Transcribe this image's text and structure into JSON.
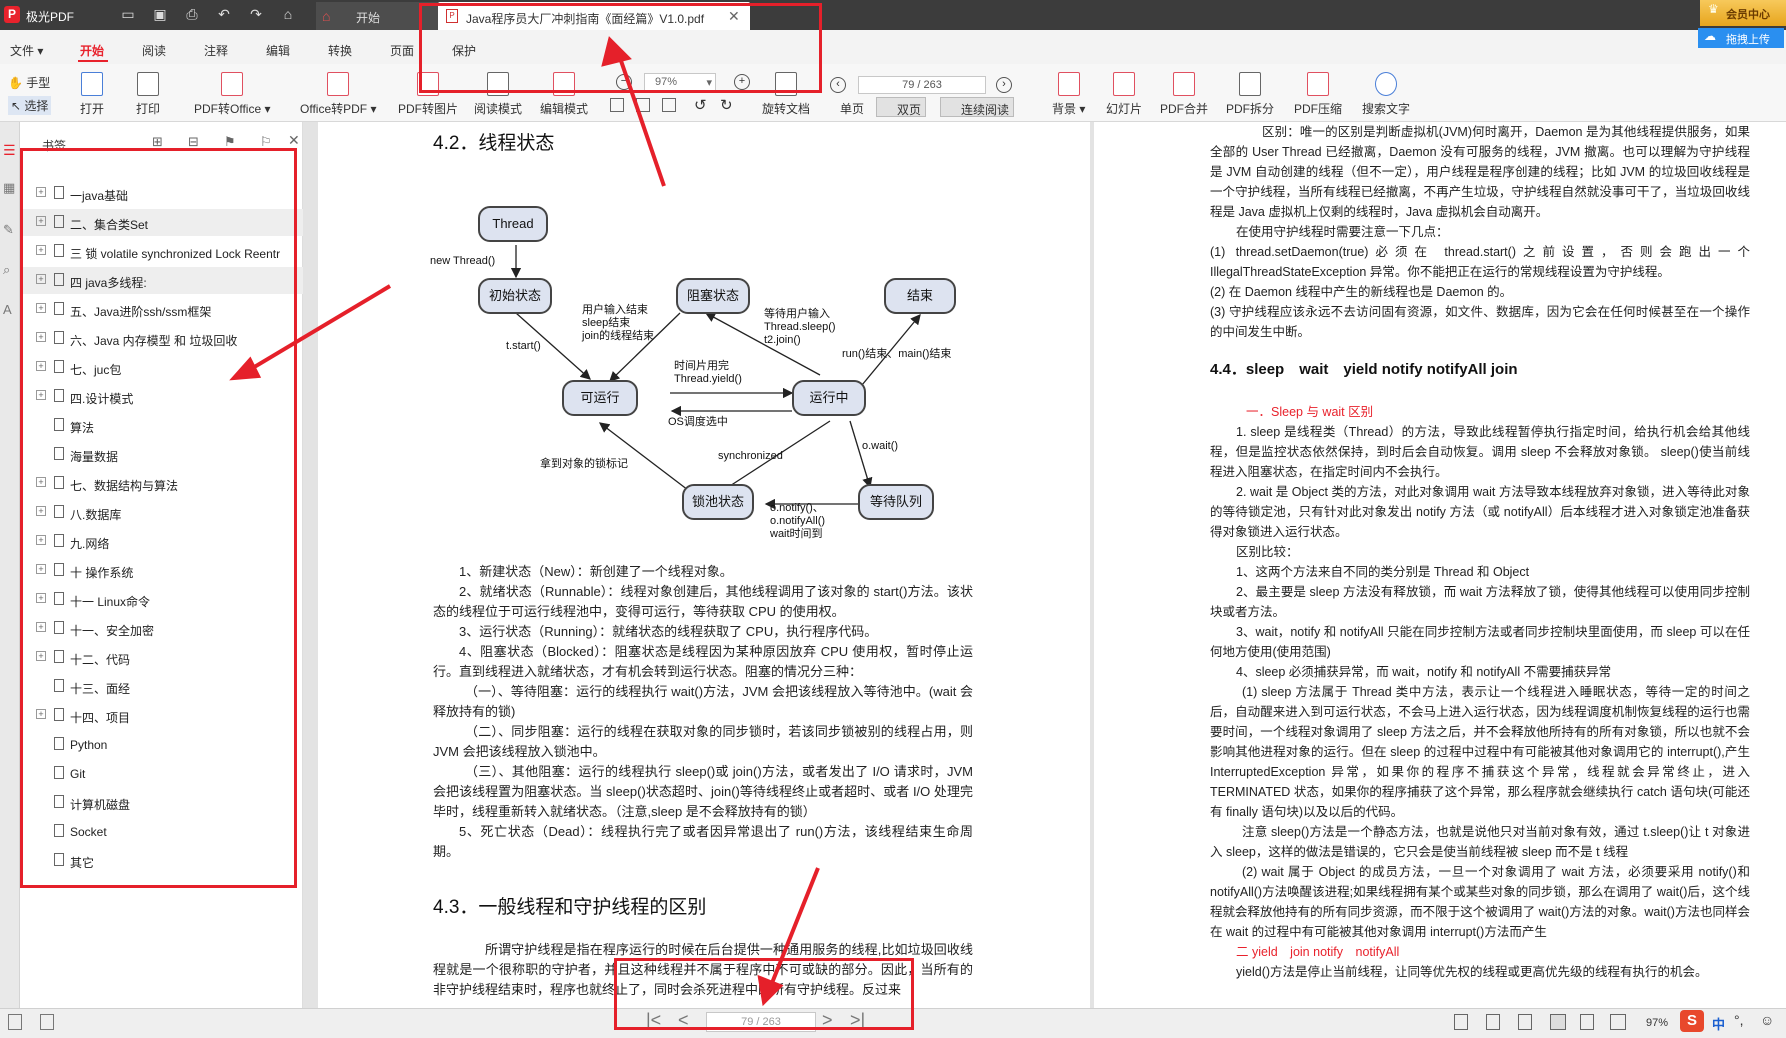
{
  "app": {
    "name": "极光PDF"
  },
  "tabs": [
    {
      "label": "开始"
    },
    {
      "label": "Java程序员大厂冲刺指南《面经篇》V1.0.pdf"
    }
  ],
  "vip_label": "会员中心",
  "upload_label": "拖拽上传",
  "menu": [
    "文件",
    "开始",
    "阅读",
    "注释",
    "编辑",
    "转换",
    "页面",
    "保护"
  ],
  "toolbar": {
    "hand": "手型",
    "select": "选择",
    "open": "打开",
    "print": "打印",
    "pdf_to_office": "PDF转Office",
    "office_to_pdf": "Office转PDF",
    "pdf_to_image": "PDF转图片",
    "read_mode": "阅读模式",
    "edit_mode": "编辑模式",
    "zoom": "97%",
    "rotate_doc": "旋转文档",
    "page_indicator": "79 / 263",
    "single_page": "单页",
    "double_page": "双页",
    "continuous": "连续阅读",
    "background": "背景",
    "slideshow": "幻灯片",
    "pdf_merge": "PDF合并",
    "pdf_split": "PDF拆分",
    "pdf_compress": "PDF压缩",
    "search_text": "搜索文字"
  },
  "bookmarks": {
    "title": "书签",
    "items": [
      {
        "label": "一java基础",
        "expandable": true
      },
      {
        "label": "二、集合类Set",
        "expandable": true
      },
      {
        "label": "三 锁 volatile synchronized Lock Reentr",
        "expandable": true
      },
      {
        "label": "四 java多线程:",
        "expandable": true
      },
      {
        "label": "五、Java进阶ssh/ssm框架",
        "expandable": true
      },
      {
        "label": "六、Java 内存模型 和 垃圾回收",
        "expandable": true
      },
      {
        "label": "七、juc包",
        "expandable": true
      },
      {
        "label": "四.设计模式",
        "expandable": true
      },
      {
        "label": "算法",
        "expandable": false
      },
      {
        "label": "海量数据",
        "expandable": false
      },
      {
        "label": "七、数据结构与算法",
        "expandable": true
      },
      {
        "label": "八.数据库",
        "expandable": true
      },
      {
        "label": "九.网络",
        "expandable": true
      },
      {
        "label": "十 操作系统",
        "expandable": true
      },
      {
        "label": "十一 Linux命令",
        "expandable": true
      },
      {
        "label": "十一、安全加密",
        "expandable": true
      },
      {
        "label": "十二、代码",
        "expandable": true
      },
      {
        "label": "十三、面经",
        "expandable": false
      },
      {
        "label": "十四、项目",
        "expandable": true
      },
      {
        "label": "Python",
        "expandable": false
      },
      {
        "label": "Git",
        "expandable": false
      },
      {
        "label": "计算机磁盘",
        "expandable": false
      },
      {
        "label": "Socket",
        "expandable": false
      },
      {
        "label": "其它",
        "expandable": false
      }
    ]
  },
  "left_page": {
    "heading1": "4.2．线程状态",
    "diagram": {
      "thread": "Thread",
      "init": "初始状态",
      "blocked": "阻塞状态",
      "end": "结束",
      "runnable": "可运行",
      "running": "运行中",
      "lockpool": "锁池状态",
      "waitqueue": "等待队列",
      "l_new": "new Thread()",
      "l_start": "t.start()",
      "l_input_end": "用户输入结束\nsleep结束\njoin的线程结束",
      "l_wait_input": "等待用户输入\nThread.sleep()\nt2.join()",
      "l_runend": "run()结束、main()结束",
      "l_timeslice": "时间片用完\nThread.yield()",
      "l_os": "OS调度选中",
      "l_sync": "synchronized",
      "l_lockmark": "拿到对象的锁标记",
      "l_owait": "o.wait()",
      "l_notify": "o.notify()、\no.notifyAll()\nwait时间到"
    },
    "paragraphs": [
      "1、新建状态（New）：新创建了一个线程对象。",
      "2、就绪状态（Runnable）：线程对象创建后，其他线程调用了该对象的 start()方法。该状态的线程位于可运行线程池中，变得可运行，等待获取 CPU 的使用权。",
      "3、运行状态（Running）：就绪状态的线程获取了 CPU，执行程序代码。",
      "4、阻塞状态（Blocked）：阻塞状态是线程因为某种原因放弃 CPU 使用权，暂时停止运行。直到线程进入就绪状态，才有机会转到运行状态。阻塞的情况分三种：",
      "（一）、等待阻塞：运行的线程执行 wait()方法，JVM 会把该线程放入等待池中。(wait 会释放持有的锁)",
      "（二）、同步阻塞：运行的线程在获取对象的同步锁时，若该同步锁被别的线程占用，则 JVM 会把该线程放入锁池中。",
      "（三）、其他阻塞：运行的线程执行 sleep()或 join()方法，或者发出了 I/O 请求时，JVM 会把该线程置为阻塞状态。当 sleep()状态超时、join()等待线程终止或者超时、或者 I/O 处理完毕时，线程重新转入就绪状态。（注意,sleep 是不会释放持有的锁）",
      "5、死亡状态（Dead）：线程执行完了或者因异常退出了 run()方法，该线程结束生命周期。"
    ],
    "heading2": "4.3．一般线程和守护线程的区别",
    "tail": "所谓守护线程是指在程序运行的时候在后台提供一种通用服务的线程,比如垃圾回收线程就是一个很称职的守护者，并且这种线程并不属于程序中不可或缺的部分。因此，当所有的非守护线程结束时，程序也就终止了，同时会杀死进程中的所有守护线程。反过来"
  },
  "right_page": {
    "p1": "区别：唯一的区别是判断虚拟机(JVM)何时离开，Daemon 是为其他线程提供服务，如果全部的 User Thread 已经撤离，Daemon 没有可服务的线程，JVM 撤离。也可以理解为守护线程是 JVM 自动创建的线程（但不一定），用户线程是程序创建的线程；比如 JVM 的垃圾回收线程是一个守护线程，当所有线程已经撤离，不再产生垃圾，守护线程自然就没事可干了，当垃圾回收线程是 Java 虚拟机上仅剩的线程时，Java 虚拟机会自动离开。",
    "p2": "在使用守护线程时需要注意一下几点：",
    "p3": "(1) thread.setDaemon(true)必须在 thread.start()之前设置，否则会跑出一个 IllegalThreadStateException 异常。你不能把正在运行的常规线程设置为守护线程。",
    "p4": "(2) 在 Daemon 线程中产生的新线程也是 Daemon 的。",
    "p5": "(3) 守护线程应该永远不去访问固有资源，如文件、数据库，因为它会在任何时候甚至在一个操作的中间发生中断。",
    "heading": "4.4．sleep　wait　yield notify notifyAll join",
    "sub1": "一．Sleep 与 wait 区别",
    "q1": "1. sleep 是线程类（Thread）的方法，导致此线程暂停执行指定时间，给执行机会给其他线程，但是监控状态依然保持，到时后会自动恢复。调用 sleep 不会释放对象锁。 sleep()使当前线程进入阻塞状态，在指定时间内不会执行。",
    "q2": "2. wait 是 Object 类的方法，对此对象调用 wait 方法导致本线程放弃对象锁，进入等待此对象的等待锁定池，只有针对此对象发出 notify 方法（或 notifyAll）后本线程才进入对象锁定池准备获得对象锁进入运行状态。",
    "q3": "区别比较：",
    "q4": "1、这两个方法来自不同的类分别是 Thread 和 Object",
    "q5": "2、最主要是 sleep 方法没有释放锁，而 wait 方法释放了锁，使得其他线程可以使用同步控制块或者方法。",
    "q6": "3、wait，notify 和 notifyAll 只能在同步控制方法或者同步控制块里面使用，而 sleep 可以在任何地方使用(使用范围)",
    "q7": "4、sleep 必须捕获异常，而 wait，notify 和 notifyAll 不需要捕获异常",
    "q8": "(1) sleep 方法属于 Thread 类中方法，表示让一个线程进入睡眠状态，等待一定的时间之后，自动醒来进入到可运行状态，不会马上进入运行状态，因为线程调度机制恢复线程的运行也需要时间，一个线程对象调用了 sleep 方法之后，并不会释放他所持有的所有对象锁，所以也就不会影响其他进程对象的运行。但在 sleep 的过程中过程中有可能被其他对象调用它的 interrupt(),产生 InterruptedException 异常，如果你的程序不捕获这个异常，线程就会异常终止，进入 TERMINATED 状态，如果你的程序捕获了这个异常，那么程序就会继续执行 catch 语句块(可能还有 finally 语句块)以及以后的代码。",
    "q9": "注意 sleep()方法是一个静态方法，也就是说他只对当前对象有效，通过 t.sleep()让 t 对象进入 sleep，这样的做法是错误的，它只会是使当前线程被 sleep 而不是 t 线程",
    "q10": "(2) wait 属于 Object 的成员方法，一旦一个对象调用了 wait 方法，必须要采用 notify()和 notifyAll()方法唤醒该进程;如果线程拥有某个或某些对象的同步锁，那么在调用了 wait()后，这个线程就会释放他持有的所有同步资源，而不限于这个被调用了 wait()方法的对象。wait()方法也同样会在 wait 的过程中有可能被其他对象调用 interrupt()方法而产生",
    "sub2": "二 yield　join notify　notifyAll",
    "q11": "yield()方法是停止当前线程，让同等优先权的线程或更高优先级的线程有执行的机会。"
  },
  "statusbar": {
    "page": "79 / 263",
    "zoom": "97%",
    "ime_cn": "中"
  }
}
